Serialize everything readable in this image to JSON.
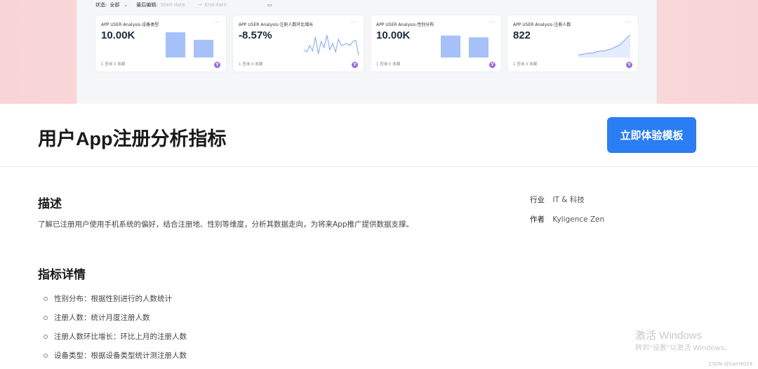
{
  "preview": {
    "filters": {
      "status_label": "状态:",
      "status_value": "全部",
      "last_edit_label": "最后编辑:",
      "start_placeholder": "Start date",
      "end_placeholder": "End date"
    },
    "cards": [
      {
        "title": "APP USER Analysis-设备类型",
        "value": "10.00K",
        "footer": "1 查询 0 收藏",
        "badge": "Y"
      },
      {
        "title": "APP USER Analysis-注册人数环比增长",
        "value": "-8.57%",
        "footer": "1 查询 0 收藏",
        "badge": "Y"
      },
      {
        "title": "APP USER Analysis-性别分布",
        "value": "10.00K",
        "footer": "1 查询 0 收藏",
        "badge": "Y"
      },
      {
        "title": "APP USER Analysis-注册人数",
        "value": "822",
        "footer": "1 查询 0 收藏",
        "badge": "Y"
      }
    ],
    "bar_values_card1": [
      1.0,
      0.7
    ],
    "bar_values_card3": [
      0.87,
      0.8
    ],
    "spark_card2": [
      0.3,
      0.2,
      0.5,
      0.25,
      0.9,
      0.1,
      0.7,
      0.4,
      1.0,
      0.3,
      0.6,
      0.2,
      0.8,
      0.5,
      0.55,
      0.6,
      0.5,
      0.7,
      0.75,
      0.05
    ],
    "trend_card4": [
      0.05,
      0.08,
      0.1,
      0.12,
      0.15,
      0.14,
      0.2,
      0.22,
      0.25,
      0.24,
      0.3,
      0.32,
      0.38,
      0.45,
      0.5,
      0.62,
      0.75,
      0.9,
      1.0
    ],
    "accent": "#a6c1f8",
    "line_color": "#7ea3f0"
  },
  "header": {
    "title": "用户App注册分析指标",
    "cta_label": "立即体验模板"
  },
  "description": {
    "heading": "描述",
    "text": "了解已注册用户使用手机系统的偏好，结合注册地、性别等维度，分析其数据走向，为将来App推广提供数据支撑。"
  },
  "meta": {
    "industry_label": "行业",
    "industry_value": "IT & 科技",
    "author_label": "作者",
    "author_value": "Kyligence Zen"
  },
  "details": {
    "heading": "指标详情",
    "items": [
      "性别分布：根据性别进行的人数统计",
      "注册人数：统计月度注册人数",
      "注册人数环比增长：环比上月的注册人数",
      "设备类型：根据设备类型统计测注册人数"
    ]
  },
  "watermark": {
    "line1": "激活 Windows",
    "line2": "转到\"设置\"以激活 Windows。"
  },
  "credit": "CSDN @Sam9029",
  "colors": {
    "cta": "#2a7df2",
    "badge": "#9b6ce0"
  }
}
